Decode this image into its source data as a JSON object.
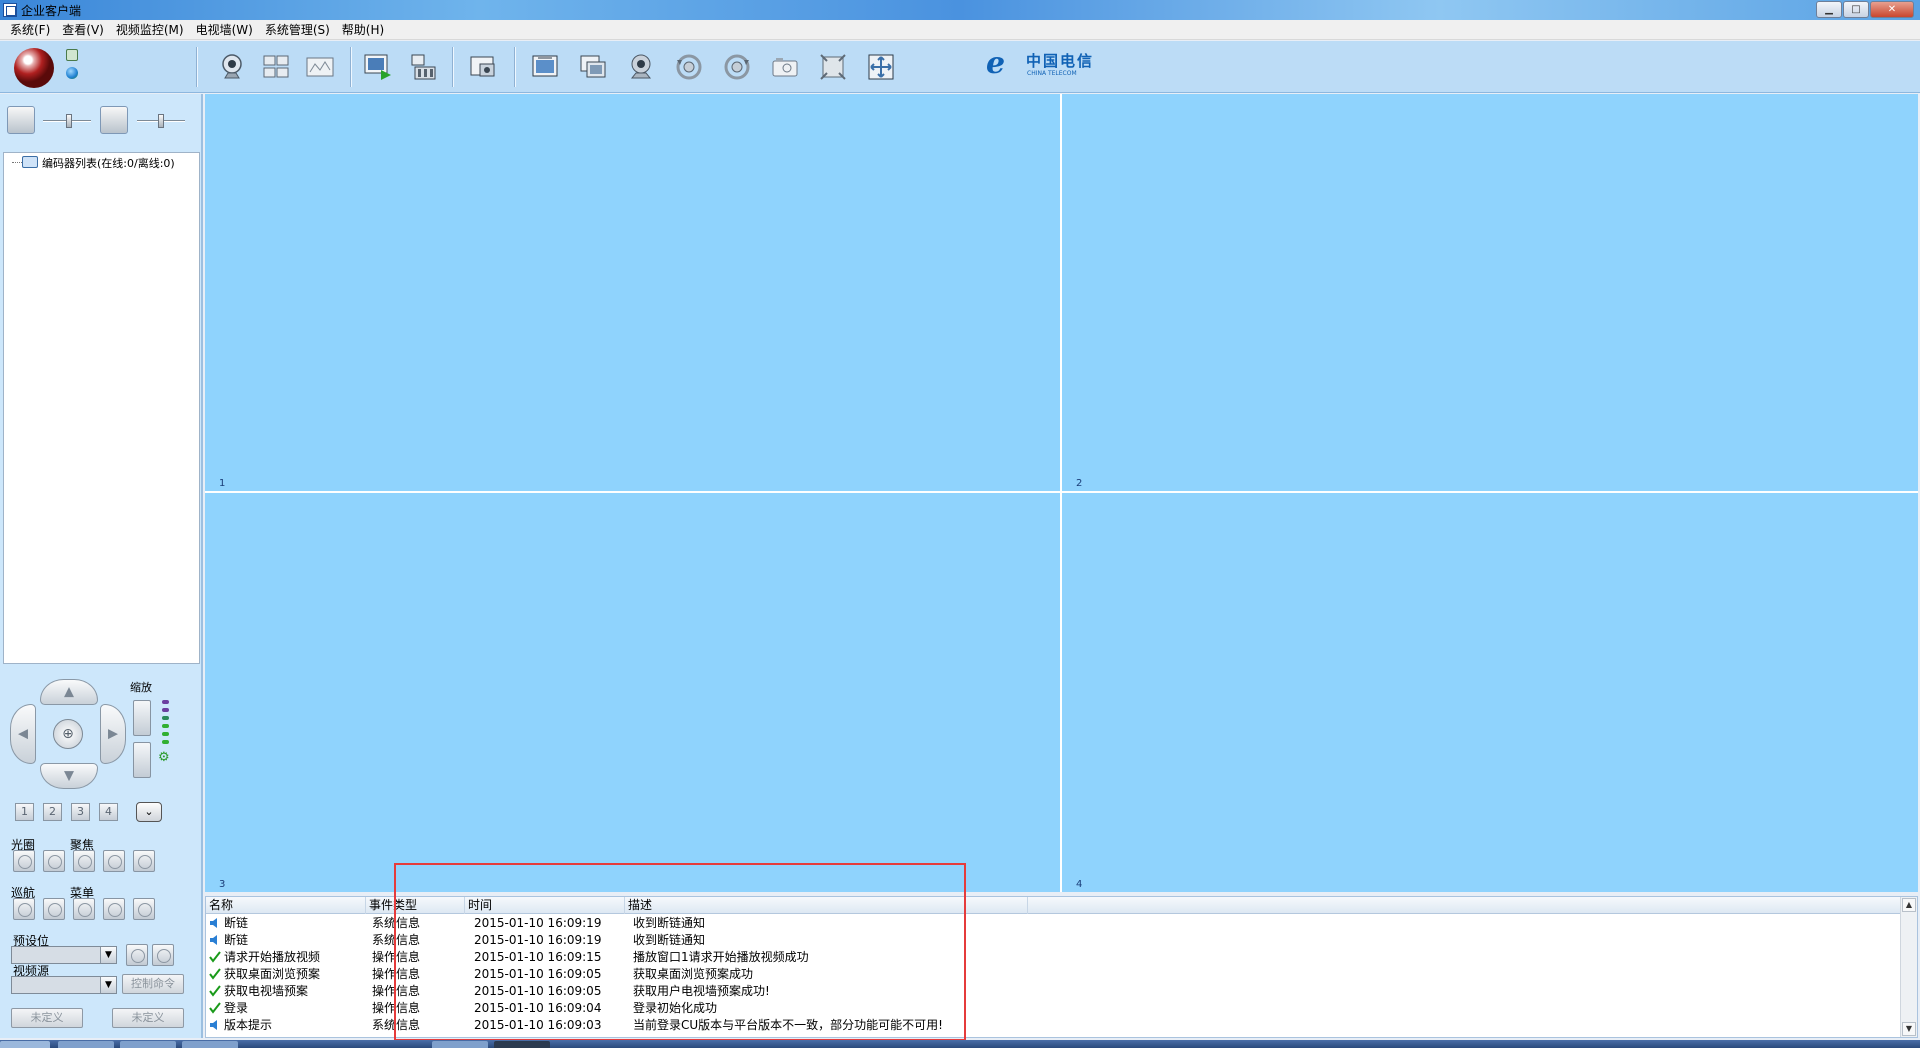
{
  "window": {
    "title": "企业客户端",
    "min_label": "▁",
    "max_label": "□",
    "close_label": "✕"
  },
  "menu": [
    {
      "label": "系统(F)"
    },
    {
      "label": "查看(V)"
    },
    {
      "label": "视频监控(M)"
    },
    {
      "label": "电视墙(W)"
    },
    {
      "label": "系统管理(S)"
    },
    {
      "label": "帮助(H)"
    }
  ],
  "toolbar": {
    "buttons": [
      {
        "icon": "webcam-icon"
      },
      {
        "icon": "grid-layout-icon"
      },
      {
        "icon": "map-icon"
      },
      {
        "icon": "playback-icon"
      },
      {
        "icon": "video-record-icon"
      },
      {
        "icon": "snapshot-icon"
      },
      {
        "icon": "fullscreen-window-icon"
      },
      {
        "icon": "window-switch-icon"
      },
      {
        "icon": "camera-ball-icon"
      },
      {
        "icon": "rotate-left-icon"
      },
      {
        "icon": "rotate-right-icon"
      },
      {
        "icon": "camera-icon"
      },
      {
        "icon": "fit-window-icon"
      },
      {
        "icon": "expand-icon"
      }
    ],
    "brand_cn": "中国电信",
    "brand_en": "CHINA TELECOM",
    "brand_mark": "ℯ"
  },
  "tree": {
    "root_label": "编码器列表(在线:0/离线:0)"
  },
  "ptz": {
    "zoom_label": "缩放",
    "presets": [
      "1",
      "2",
      "3",
      "4"
    ],
    "dropdown_glyph": "⌄",
    "iris_label": "光圈",
    "focus_label": "聚焦",
    "cruise_label": "巡航",
    "menu_label": "菜单",
    "preset_label": "预设位",
    "video_source_label": "视频源",
    "control_cmd_label": "控制命令",
    "undefined_1": "未定义",
    "undefined_2": "未定义",
    "center_glyph": "⊕"
  },
  "video_panes": [
    "1",
    "2",
    "3",
    "4"
  ],
  "log": {
    "columns": [
      "名称",
      "事件类型",
      "时间",
      "描述"
    ],
    "rows": [
      {
        "icon": "speaker-icon",
        "name": "断链",
        "type": "系统信息",
        "time": "2015-01-10 16:09:19",
        "desc": "收到断链通知"
      },
      {
        "icon": "speaker-icon",
        "name": "断链",
        "type": "系统信息",
        "time": "2015-01-10 16:09:19",
        "desc": "收到断链通知"
      },
      {
        "icon": "check-icon",
        "name": "请求开始播放视频",
        "type": "操作信息",
        "time": "2015-01-10 16:09:15",
        "desc": "播放窗口1请求开始播放视频成功"
      },
      {
        "icon": "check-icon",
        "name": "获取桌面浏览预案",
        "type": "操作信息",
        "time": "2015-01-10 16:09:05",
        "desc": "获取桌面浏览预案成功"
      },
      {
        "icon": "check-icon",
        "name": "获取电视墙预案",
        "type": "操作信息",
        "time": "2015-01-10 16:09:05",
        "desc": "获取用户电视墙预案成功!"
      },
      {
        "icon": "check-icon",
        "name": "登录",
        "type": "操作信息",
        "time": "2015-01-10 16:09:04",
        "desc": "登录初始化成功"
      },
      {
        "icon": "speaker-icon",
        "name": "版本提示",
        "type": "系统信息",
        "time": "2015-01-10 16:09:03",
        "desc": "当前登录CU版本与平台版本不一致，部分功能可能不可用!"
      }
    ]
  },
  "colors": {
    "video_bg": "#8fd3fd",
    "panel_bg": "#cde7fb",
    "highlight": "#e53b3b",
    "check": "#1a9a1a",
    "speaker": "#2a7fd4"
  }
}
